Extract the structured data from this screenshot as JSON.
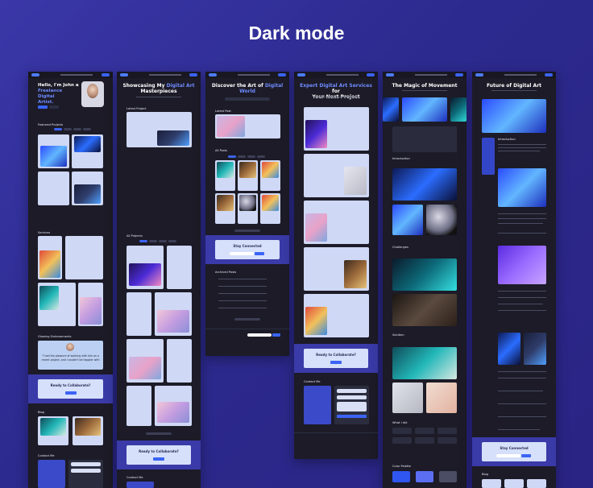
{
  "heading": "Dark mode",
  "screens": {
    "s1": {
      "hero_line1": "Hello, I'm John a",
      "hero_line2": "Freelance Digital",
      "hero_line3": "Artist.",
      "section_featured": "Featured Projects",
      "section_services": "Services",
      "section_endorsements": "Glowing Endorsements",
      "quote": "\"I had the pleasure of working with him on a recent project, and I couldn't be happier with the results.\"",
      "cta_title": "Ready to Collaborate?",
      "section_blog": "Blog",
      "section_contact": "Contact Me"
    },
    "s2": {
      "title_a": "Showcasing My ",
      "title_hl": "Digital Art",
      "title_b": "Masterpieces",
      "section_latest": "Latest Project",
      "section_all": "All Projects",
      "cta_title": "Ready to Collaborate?",
      "section_contact": "Contact Me"
    },
    "s3": {
      "title_a": "Discover the Art of ",
      "title_hl": "Digital",
      "title_b": "World",
      "section_latest": "Latest Post",
      "section_all": "All Posts",
      "stay_title": "Stay Connected",
      "section_archived": "Archived Posts"
    },
    "s4": {
      "title_hl": "Expert Digital Art Services",
      "title_a": " for",
      "title_b": "Your Next Project",
      "cta_title": "Ready to Collaborate?",
      "section_contact": "Contact Me"
    },
    "s5": {
      "title": "The Magic of Movement",
      "section_intro": "Introduction",
      "section_challenges": "Challenges",
      "section_solution": "Solution",
      "section_role": "What I did",
      "section_palette": "Color Palette"
    },
    "s6": {
      "title": "Future of Digital Art",
      "section_intro": "Introduction",
      "stay_title": "Stay Connected",
      "section_blog": "Blog"
    }
  }
}
